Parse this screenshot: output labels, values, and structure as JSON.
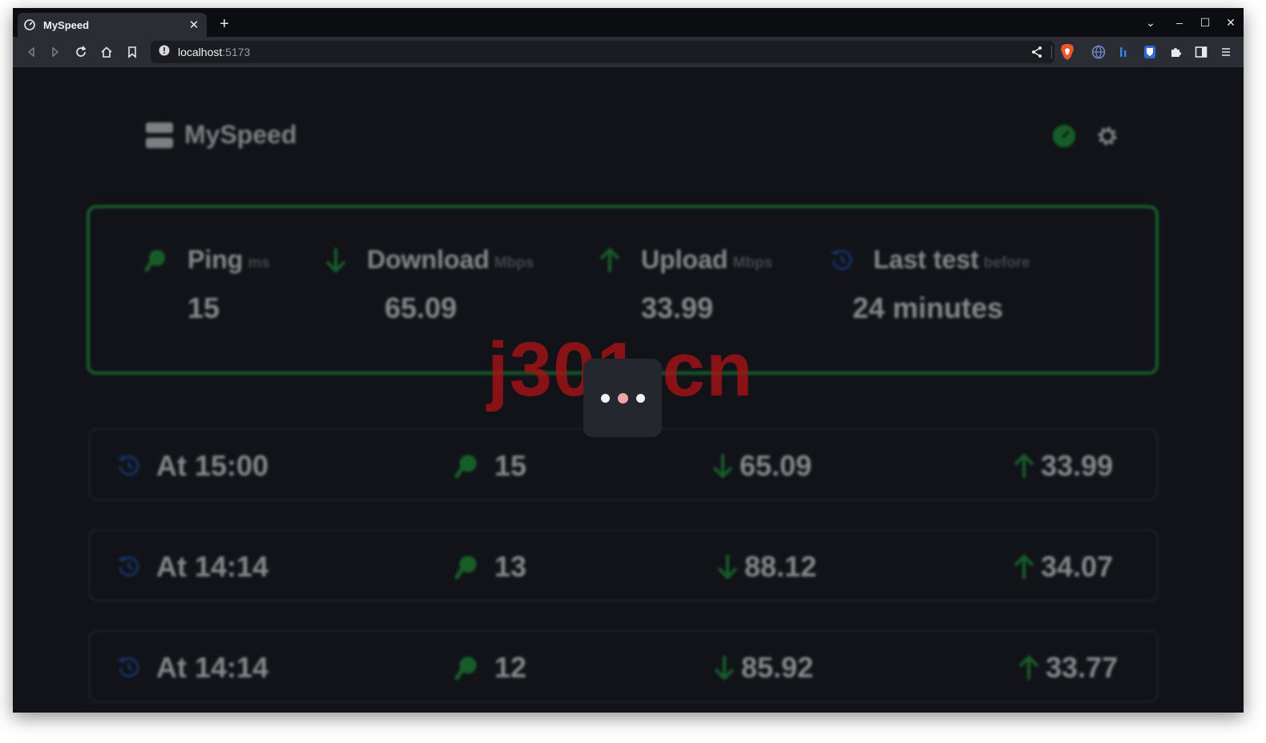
{
  "browser": {
    "tab_title": "MySpeed",
    "tab_close": "✕",
    "new_tab": "+",
    "url_host": "localhost",
    "url_port": ":5173",
    "controls": {
      "chevron": "⌄",
      "minimize": "–",
      "maximize": "☐",
      "close": "✕"
    }
  },
  "app": {
    "name": "MySpeed",
    "accent_color": "#1f9b35",
    "history_icon_color": "#1d4fa3"
  },
  "stats": {
    "ping": {
      "label": "Ping",
      "unit": "ms",
      "value": "15"
    },
    "download": {
      "label": "Download",
      "unit": "Mbps",
      "value": "65.09"
    },
    "upload": {
      "label": "Upload",
      "unit": "Mbps",
      "value": "33.99"
    },
    "last_test": {
      "label": "Last test",
      "unit": "before",
      "value": "24 minutes"
    }
  },
  "history": [
    {
      "time": "At 15:00",
      "ping": "15",
      "download": "65.09",
      "upload": "33.99"
    },
    {
      "time": "At 14:14",
      "ping": "13",
      "download": "88.12",
      "upload": "34.07"
    },
    {
      "time": "At 14:14",
      "ping": "12",
      "download": "85.92",
      "upload": "33.77"
    }
  ],
  "watermark": "j301.cn"
}
